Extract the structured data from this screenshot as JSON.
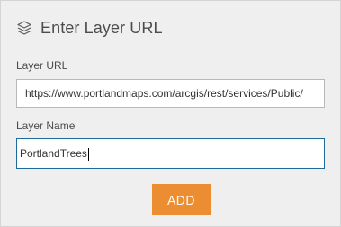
{
  "dialog": {
    "title": "Enter Layer URL",
    "header_icon": "layers-icon"
  },
  "layer_url": {
    "label": "Layer URL",
    "value": "https://www.portlandmaps.com/arcgis/rest/services/Public/"
  },
  "layer_name": {
    "label": "Layer Name",
    "value": "PortlandTrees"
  },
  "actions": {
    "add_label": "ADD"
  },
  "colors": {
    "panel_bg": "#efefef",
    "add_button_bg": "#ed8d31",
    "focused_border": "#1c6b9c"
  }
}
